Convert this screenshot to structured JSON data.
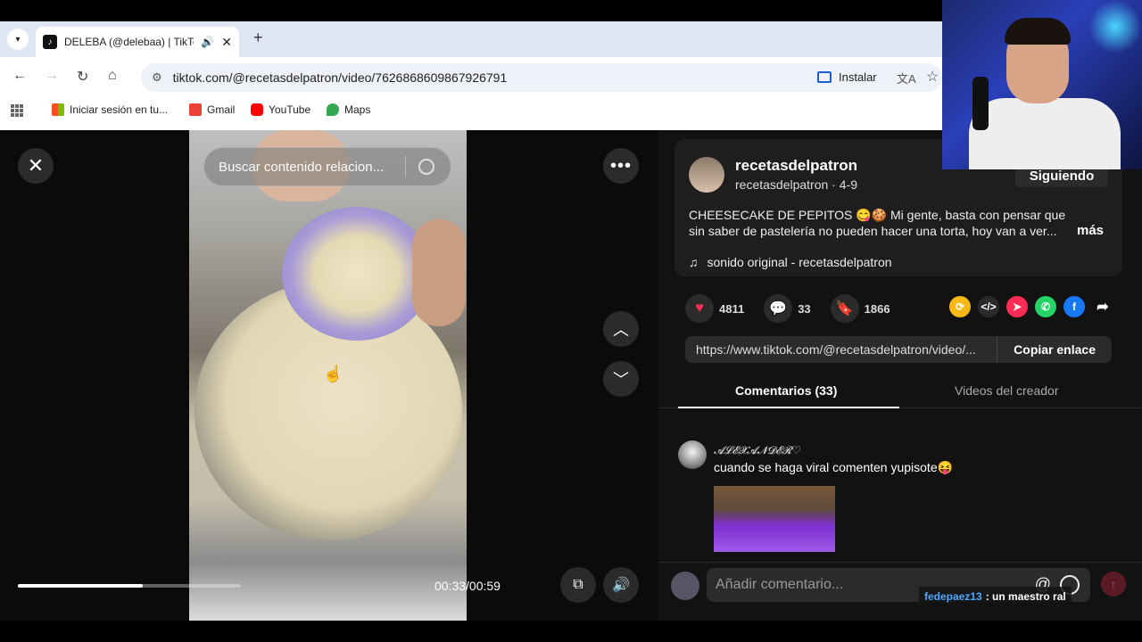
{
  "browser": {
    "tab_title": "DELEBA (@delebaa) | TikTok",
    "url": "tiktok.com/@recetasdelpatron/video/7626868609867926791",
    "install_label": "Instalar",
    "bookmarks": [
      "Iniciar sesión en tu...",
      "Gmail",
      "YouTube",
      "Maps"
    ]
  },
  "video": {
    "search_placeholder": "Buscar contenido relacion...",
    "time": "00:33/00:59",
    "progress": 0.56
  },
  "post": {
    "display_name": "recetasdelpatron",
    "handle": "recetasdelpatron",
    "date": "4-9",
    "follow_label": "Siguiendo",
    "description": "CHEESECAKE DE PEPITOS 😋🍪 Mi gente, basta con pensar que sin saber de pastelería no pueden hacer una torta, hoy van a ver...",
    "more_label": "más",
    "sound": "sonido original - recetasdelpatron",
    "likes": "4811",
    "comments": "33",
    "saves": "1866",
    "link": "https://www.tiktok.com/@recetasdelpatron/video/...",
    "copy_label": "Copiar enlace"
  },
  "panel_tabs": [
    "Comentarios (33)",
    "Videos del creador"
  ],
  "comments": [
    {
      "user": "𝓐𝓛𝓔𝓧𝓐𝓝𝓓𝓔𝓡♡",
      "text": "cuando se haga viral comenten yupisote😝"
    }
  ],
  "composer": {
    "placeholder": "Añadir comentario..."
  },
  "chat_overlay": {
    "user": "fedepaez13",
    "message": ": un maestro ral"
  },
  "colors": {
    "like": "#fe2c55",
    "save": "#facb12",
    "background": "#121212"
  }
}
